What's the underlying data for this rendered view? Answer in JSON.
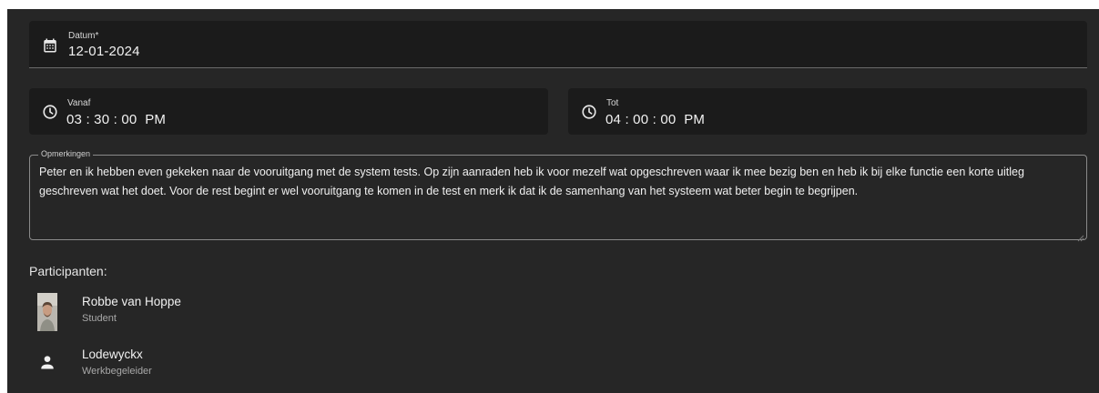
{
  "date": {
    "label": "Datum*",
    "value": "12-01-2024",
    "icon": "calendar-icon"
  },
  "from": {
    "label": "Vanaf",
    "value": "03 : 30 : 00  PM",
    "icon": "clock-icon"
  },
  "to": {
    "label": "Tot",
    "value": "04 : 00 : 00  PM",
    "icon": "clock-icon"
  },
  "notes": {
    "label": "Opmerkingen",
    "value": "Peter en ik hebben even gekeken naar de vooruitgang met de system tests. Op zijn aanraden heb ik voor mezelf wat opgeschreven waar ik mee bezig ben en heb ik bij elke functie een korte uitleg geschreven wat het doet. Voor de rest begint er wel vooruitgang te komen in de test en merk ik dat ik de samenhang van het systeem wat beter begin te begrijpen."
  },
  "participants": {
    "title": "Participanten:",
    "items": [
      {
        "name": "Robbe van Hoppe",
        "role": "Student",
        "avatar": "photo"
      },
      {
        "name": "Lodewyckx",
        "role": "Werkbegeleider",
        "avatar": "person-icon"
      }
    ]
  },
  "colors": {
    "background": "#262626",
    "field_background": "#1b1b1b",
    "text": "#ffffff",
    "secondary_text": "#a8a8a8"
  }
}
